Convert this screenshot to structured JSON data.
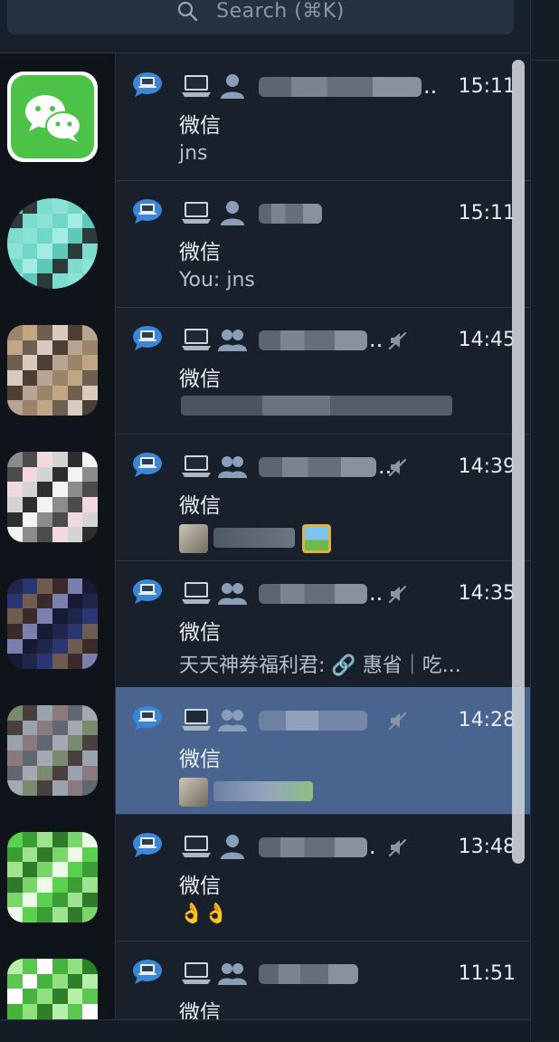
{
  "search": {
    "placeholder": "Search (⌘K)"
  },
  "sidebar": {
    "avatars": [
      {
        "name": "wechat"
      },
      {
        "name": "teal"
      },
      {
        "name": "beige"
      },
      {
        "name": "gray"
      },
      {
        "name": "navy"
      },
      {
        "name": "muted"
      },
      {
        "name": "green"
      },
      {
        "name": "green2"
      }
    ]
  },
  "chats": [
    {
      "time": "15:11",
      "app": "微信",
      "preview": "jns",
      "muted": false,
      "group": false,
      "selected": false,
      "suffix": ".."
    },
    {
      "time": "15:11",
      "app": "微信",
      "preview": "You: jns",
      "muted": false,
      "group": false,
      "selected": false,
      "suffix": ""
    },
    {
      "time": "14:45",
      "app": "微信",
      "preview": "",
      "muted": true,
      "group": true,
      "selected": false,
      "suffix": ".."
    },
    {
      "time": "14:39",
      "app": "微信",
      "preview": "",
      "muted": true,
      "group": true,
      "selected": false,
      "suffix": ".."
    },
    {
      "time": "14:35",
      "app": "微信",
      "preview": "天天神券福利君: 🔗 惠省｜吃...",
      "muted": true,
      "group": true,
      "selected": false,
      "suffix": ".."
    },
    {
      "time": "14:28",
      "app": "微信",
      "preview": "",
      "muted": true,
      "group": true,
      "selected": true,
      "suffix": ""
    },
    {
      "time": "13:48",
      "app": "微信",
      "preview": "👌👌",
      "muted": true,
      "group": false,
      "selected": false,
      "suffix": "."
    },
    {
      "time": "11:51",
      "app": "微信",
      "preview": "",
      "muted": false,
      "group": true,
      "selected": false,
      "suffix": ""
    }
  ],
  "icons": {
    "chat_bubble": "chat-bubble-icon",
    "laptop": "laptop-icon",
    "person": "person-icon",
    "group": "group-icon",
    "mute": "mute-icon",
    "search": "search-icon"
  },
  "colors": {
    "background": "#17202b",
    "selected": "#48648f",
    "wechat_green": "#4cc247"
  }
}
